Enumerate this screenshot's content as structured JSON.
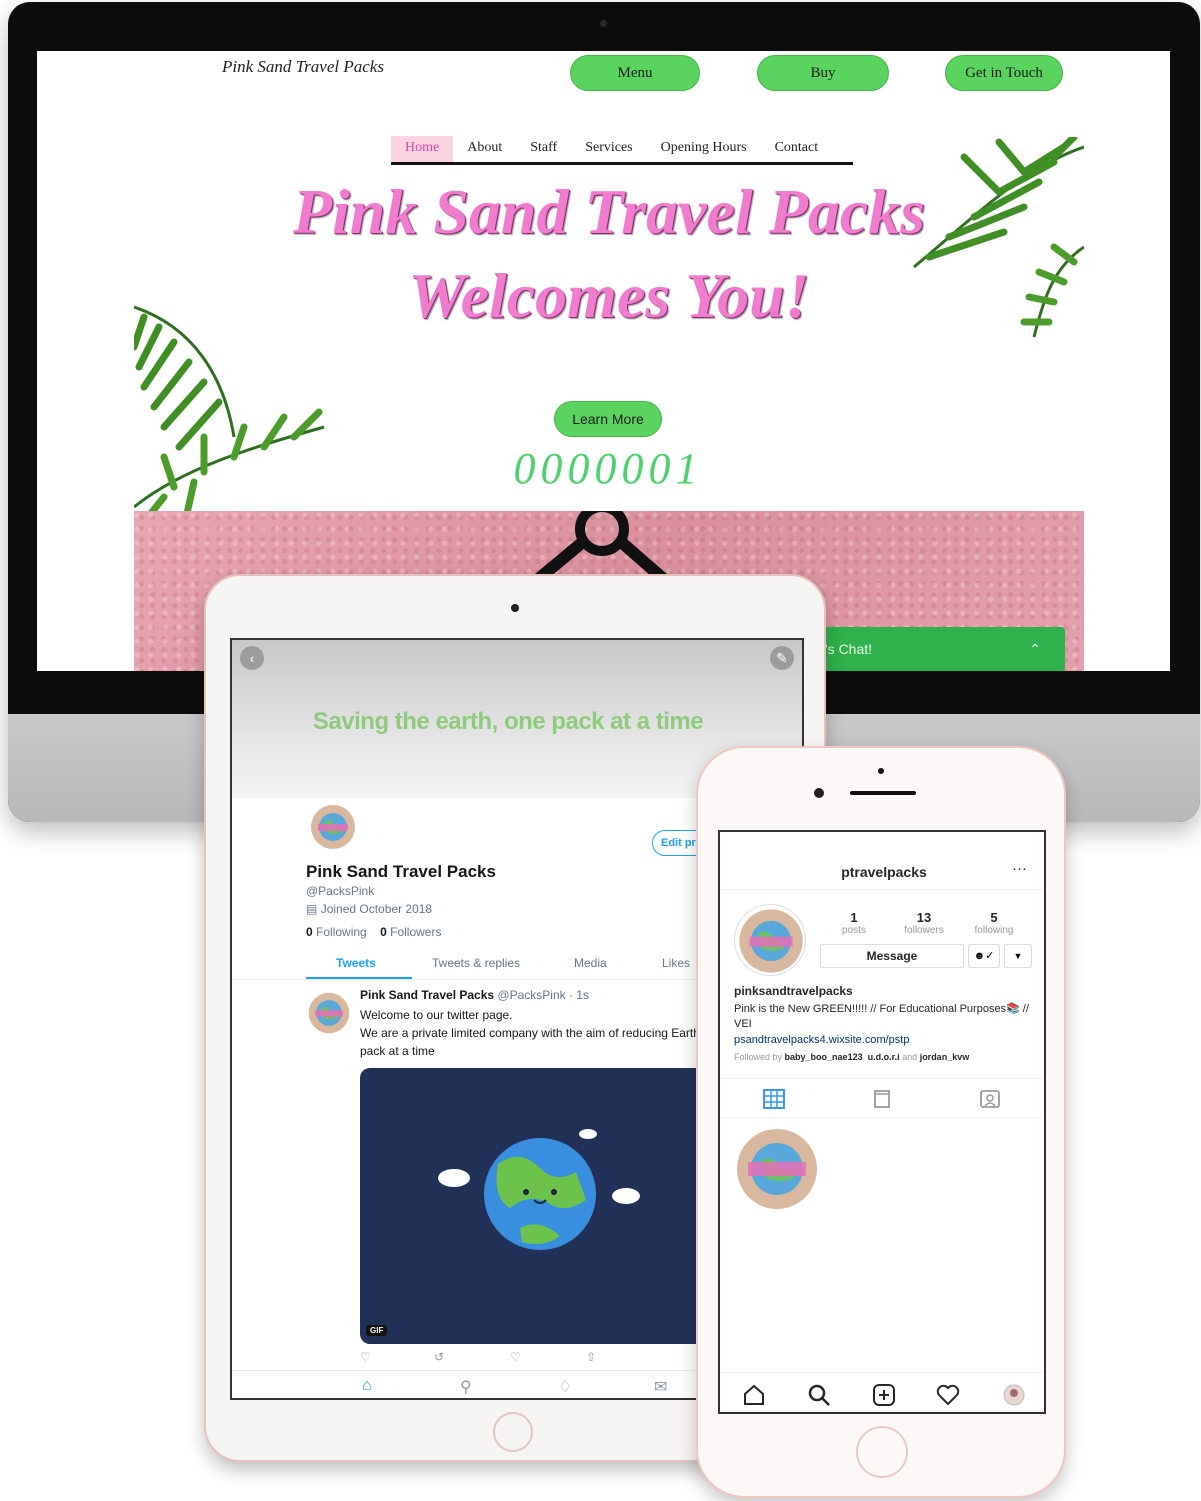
{
  "website": {
    "brand": "Pink Sand Travel Packs",
    "buttons": {
      "menu": "Menu",
      "buy": "Buy",
      "contact": "Get in Touch"
    },
    "nav": [
      "Home",
      "About",
      "Staff",
      "Services",
      "Opening Hours",
      "Contact"
    ],
    "hero_line1": "Pink Sand Travel Packs",
    "hero_line2": "Welcomes You!",
    "learn_more": "Learn More",
    "counter": "0000001",
    "chat": "'s Chat!",
    "colors": {
      "button_green": "#5bd35f",
      "hero_pink": "#ef7ccd",
      "chat_green": "#2fb14b"
    }
  },
  "twitter": {
    "banner_text": "Saving the earth, one pack at a time",
    "edit_profile": "Edit pr",
    "name": "Pink Sand Travel Packs",
    "handle": "@PacksPink",
    "joined": "Joined October 2018",
    "following_count": "0",
    "following_label": "Following",
    "followers_count": "0",
    "followers_label": "Followers",
    "tabs": [
      "Tweets",
      "Tweets & replies",
      "Media",
      "Likes"
    ],
    "tweet": {
      "author": "Pink Sand Travel Packs",
      "meta": "@PacksPink · 1s",
      "line1": "Welcome to our twitter page.",
      "line2": "We are a private limited company with the aim of reducing Earth's pollution one pack at a time",
      "gif_label": "GIF"
    },
    "icons": [
      "reply-icon",
      "retweet-icon",
      "like-icon",
      "share-icon"
    ],
    "bottom_nav": [
      "home-icon",
      "search-icon",
      "notifications-icon",
      "messages-icon"
    ],
    "colors": {
      "link_blue": "#1da1f2",
      "gif_bg": "#213056"
    }
  },
  "instagram": {
    "username": "ptravelpacks",
    "more": "···",
    "stats": [
      {
        "num": "1",
        "label": "posts"
      },
      {
        "num": "13",
        "label": "followers"
      },
      {
        "num": "5",
        "label": "following"
      }
    ],
    "message": "Message",
    "bio_name": "pinksandtravelpacks",
    "bio": "Pink is the New GREEN!!!!! // For Educational Purposes📚 // VEI",
    "link": "psandtravelpacks4.wixsite.com/pstp",
    "followed_by_prefix": "Followed by",
    "followed_by_1": "baby_boo_nae123",
    "followed_by_2": "u.d.o.r.i",
    "followed_by_and": "and",
    "followed_by_3": "jordan_kvw",
    "bottom_nav": [
      "home-icon",
      "search-icon",
      "add-icon",
      "heart-icon",
      "profile-icon"
    ]
  }
}
